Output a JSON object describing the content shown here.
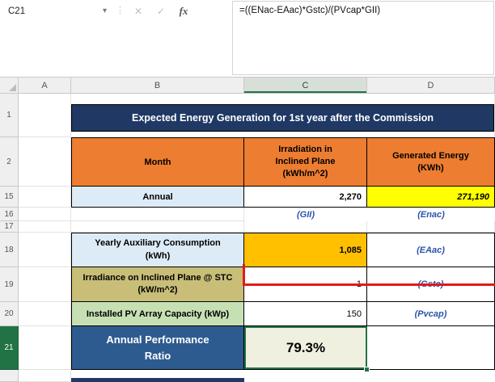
{
  "name_box": {
    "value": "C21"
  },
  "formula_bar": {
    "formula": "=((ENac-EAac)*Gstc)/(PVcap*GII)",
    "cancel_icon": "✕",
    "enter_icon": "✓",
    "fx_icon": "fx"
  },
  "grid": {
    "col_headers": {
      "a": "A",
      "b": "B",
      "c": "C",
      "d": "D"
    },
    "row_headers": {
      "r1": "1",
      "r2": "2",
      "r15": "15",
      "r16": "16",
      "r17": "17",
      "r18": "18",
      "r19": "19",
      "r20": "20",
      "r21": "21"
    }
  },
  "table": {
    "title": "Expected Energy Generation for 1st year after the Commission",
    "columns": {
      "month": "Month",
      "irradiation": "Irradiation in Inclined Plane (kWh/m^2)",
      "generated": "Generated Energy (KWh)"
    },
    "annual": {
      "label": "Annual",
      "irradiation": "2,270",
      "generated": "271,190",
      "gii_tag": "(GII)",
      "enac_tag": "(Enac)"
    },
    "aux": {
      "label": "Yearly Auxiliary Consumption (kWh)",
      "value": "1,085",
      "tag": "(EAac)"
    },
    "stc": {
      "label": "Irradiance on Inclined Plane @ STC (kW/m^2)",
      "value": "1",
      "tag": "(Gstc)"
    },
    "pv": {
      "label": "Installed PV Array Capacity (kWp)",
      "value": "150",
      "tag": "(Pvcap)"
    },
    "apr": {
      "label": "Annual Performance Ratio",
      "value": "79.3%"
    }
  },
  "colors": {
    "title_navy": "#1F3864",
    "header_orange": "#ED7D31",
    "annual_blue": "#DDEBF7",
    "highlight_yellow": "#FFFF00",
    "value_amber": "#FFC000",
    "stc_tan": "#C9BE78",
    "pv_green": "#C6E0B4",
    "apr_navy": "#2E5B8F",
    "apr_value_bg": "#F0F0E0",
    "tag_blue": "#2A55A8",
    "annotation_red": "#E01B1B",
    "selection_green": "#217346"
  }
}
